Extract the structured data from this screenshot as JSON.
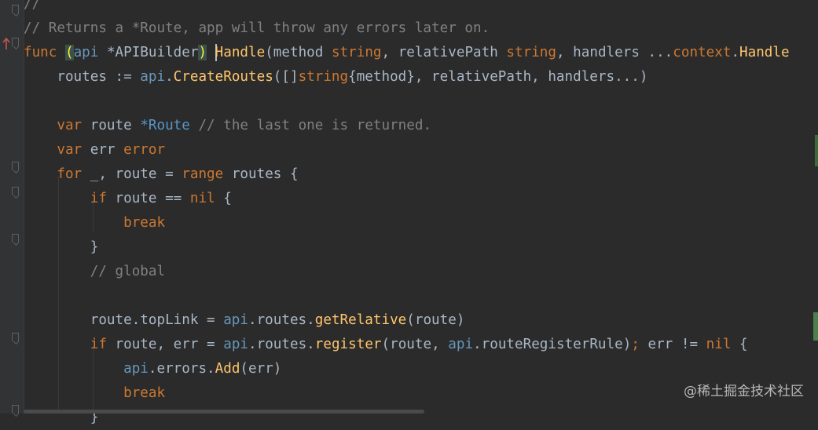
{
  "editor": {
    "lines": [
      {
        "tokens": [
          {
            "text": "//",
            "cls": "c"
          }
        ]
      },
      {
        "tokens": [
          {
            "text": "// Returns a *Route, app will throw any errors later on.",
            "cls": "c"
          }
        ]
      },
      {
        "tokens": [
          {
            "text": "func ",
            "cls": "k"
          },
          {
            "text": "(",
            "cls": "sel-brace"
          },
          {
            "text": "api ",
            "cls": "t"
          },
          {
            "text": "*APIBuilder",
            "cls": "p"
          },
          {
            "text": ")",
            "cls": "sel-brace"
          },
          {
            "text": " ",
            "cls": "p"
          },
          {
            "text": "Handle",
            "cls": "f"
          },
          {
            "text": "(method ",
            "cls": "p"
          },
          {
            "text": "string",
            "cls": "k"
          },
          {
            "text": ", relativePath ",
            "cls": "p"
          },
          {
            "text": "string",
            "cls": "k"
          },
          {
            "text": ", handlers ...",
            "cls": "p"
          },
          {
            "text": "context",
            "cls": "k"
          },
          {
            "text": ".",
            "cls": "p"
          },
          {
            "text": "Handle",
            "cls": "f"
          }
        ]
      },
      {
        "tokens": [
          {
            "text": "    routes := ",
            "cls": "p"
          },
          {
            "text": "api",
            "cls": "t"
          },
          {
            "text": ".",
            "cls": "p"
          },
          {
            "text": "CreateRoutes",
            "cls": "f"
          },
          {
            "text": "([]",
            "cls": "p"
          },
          {
            "text": "string",
            "cls": "k"
          },
          {
            "text": "{method}, relativePath, handlers...)",
            "cls": "p"
          }
        ]
      },
      {
        "tokens": []
      },
      {
        "tokens": [
          {
            "text": "    ",
            "cls": "p"
          },
          {
            "text": "var ",
            "cls": "k"
          },
          {
            "text": "route ",
            "cls": "p"
          },
          {
            "text": "*Route",
            "cls": "g"
          },
          {
            "text": " // the last one is returned.",
            "cls": "c"
          }
        ]
      },
      {
        "tokens": [
          {
            "text": "    ",
            "cls": "p"
          },
          {
            "text": "var ",
            "cls": "k"
          },
          {
            "text": "err ",
            "cls": "p"
          },
          {
            "text": "error",
            "cls": "k"
          }
        ]
      },
      {
        "tokens": [
          {
            "text": "    ",
            "cls": "p"
          },
          {
            "text": "for ",
            "cls": "k"
          },
          {
            "text": "_, route = ",
            "cls": "p"
          },
          {
            "text": "range ",
            "cls": "k"
          },
          {
            "text": "routes {",
            "cls": "p"
          }
        ]
      },
      {
        "tokens": [
          {
            "text": "        ",
            "cls": "p"
          },
          {
            "text": "if ",
            "cls": "k"
          },
          {
            "text": "route == ",
            "cls": "p"
          },
          {
            "text": "nil",
            "cls": "k"
          },
          {
            "text": " {",
            "cls": "p"
          }
        ]
      },
      {
        "tokens": [
          {
            "text": "            ",
            "cls": "p"
          },
          {
            "text": "break",
            "cls": "k"
          }
        ]
      },
      {
        "tokens": [
          {
            "text": "        }",
            "cls": "p"
          }
        ]
      },
      {
        "tokens": [
          {
            "text": "        // global",
            "cls": "c"
          }
        ]
      },
      {
        "tokens": []
      },
      {
        "tokens": [
          {
            "text": "        route.topLink = ",
            "cls": "p"
          },
          {
            "text": "api",
            "cls": "t"
          },
          {
            "text": ".routes.",
            "cls": "p"
          },
          {
            "text": "getRelative",
            "cls": "f"
          },
          {
            "text": "(route)",
            "cls": "p"
          }
        ]
      },
      {
        "tokens": [
          {
            "text": "        ",
            "cls": "p"
          },
          {
            "text": "if ",
            "cls": "k"
          },
          {
            "text": "route, err = ",
            "cls": "p"
          },
          {
            "text": "api",
            "cls": "t"
          },
          {
            "text": ".routes.",
            "cls": "p"
          },
          {
            "text": "register",
            "cls": "f"
          },
          {
            "text": "(route, ",
            "cls": "p"
          },
          {
            "text": "api",
            "cls": "t"
          },
          {
            "text": ".routeRegisterRule)",
            "cls": "p"
          },
          {
            "text": "; ",
            "cls": "k"
          },
          {
            "text": "err != ",
            "cls": "p"
          },
          {
            "text": "nil",
            "cls": "k"
          },
          {
            "text": " {",
            "cls": "p"
          }
        ]
      },
      {
        "tokens": [
          {
            "text": "            ",
            "cls": "p"
          },
          {
            "text": "api",
            "cls": "t"
          },
          {
            "text": ".errors.",
            "cls": "p"
          },
          {
            "text": "Add",
            "cls": "f"
          },
          {
            "text": "(err)",
            "cls": "p"
          }
        ]
      },
      {
        "tokens": [
          {
            "text": "            ",
            "cls": "p"
          },
          {
            "text": "break",
            "cls": "k"
          }
        ]
      },
      {
        "tokens": [
          {
            "text": "        }",
            "cls": "p"
          }
        ]
      }
    ]
  },
  "watermark": "@稀土掘金技术社区"
}
